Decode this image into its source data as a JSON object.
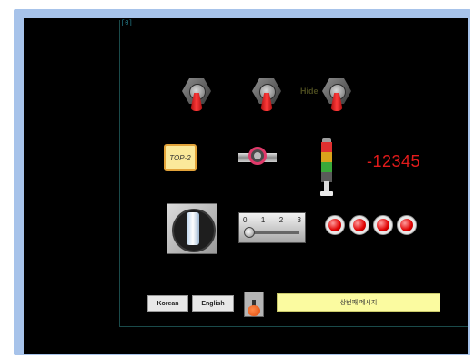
{
  "hmi": {
    "corner_label": "[0]",
    "hide_label": "Hide",
    "top2_label": "TOP-2",
    "numeric_display": "-12345",
    "slider": {
      "ticks": [
        "0",
        "1",
        "2",
        "3"
      ],
      "value": 0
    },
    "buttons": {
      "korean": "Korean",
      "english": "English"
    },
    "message_text": "상번째 메시지",
    "icons": {
      "toggle": "toggle-switch-icon",
      "valve": "valve-icon",
      "tower_light": "signal-tower-icon",
      "selector": "rotary-selector-icon",
      "lamp": "indicator-lamp-icon"
    },
    "colors": {
      "background": "#000000",
      "frame": "#a7c3ea",
      "lever": "#ff3a3a",
      "numeric": "#e31b1b",
      "lamp": "#e00000",
      "message_bg": "#fbfba0",
      "top2_bg": "#fbe99a",
      "tower_red": "#e03030",
      "tower_yellow": "#d9a21b",
      "tower_green": "#3aa83a"
    }
  }
}
